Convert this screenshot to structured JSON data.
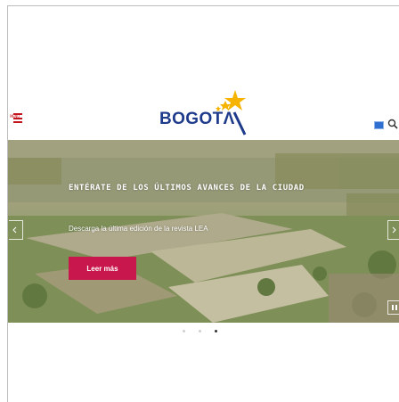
{
  "header": {
    "menu_label": "MENÚ",
    "logo_text": "BOGOTΛ",
    "colors": {
      "logo_blue": "#1e3a8a",
      "logo_star": "#f6b400",
      "menu_red": "#c3141d"
    }
  },
  "hero": {
    "headline": "ENTÉRATE DE LOS ÚLTIMOS AVANCES DE LA CIUDAD",
    "subline": "Descarga la última edición de la revista LEA",
    "cta_label": "Leer más",
    "cta_color": "#c8174c"
  },
  "carousel": {
    "slides": 3,
    "active_index": 2
  },
  "icons": [
    "hamburger-menu-icon",
    "flag-icon",
    "search-icon",
    "chevron-left-icon",
    "chevron-right-icon",
    "pause-icon"
  ]
}
